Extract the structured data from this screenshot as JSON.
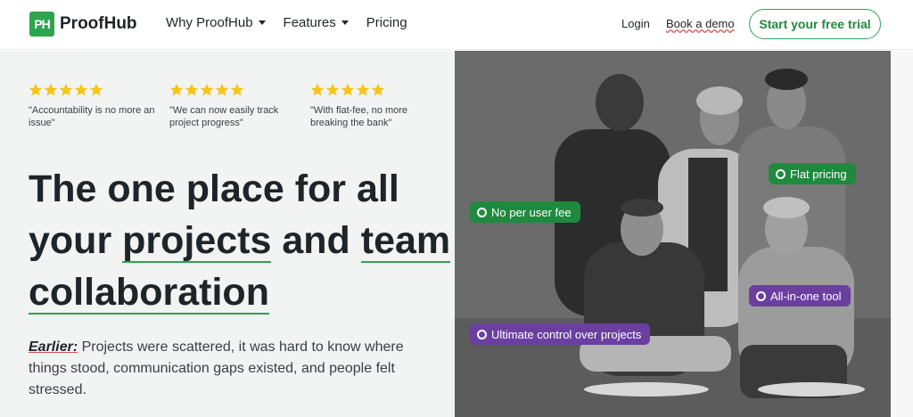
{
  "header": {
    "logo_mark": "PH",
    "logo_text": "ProofHub",
    "nav": [
      {
        "label": "Why ProofHub",
        "has_dropdown": true
      },
      {
        "label": "Features",
        "has_dropdown": true
      },
      {
        "label": "Pricing",
        "has_dropdown": false
      }
    ],
    "login_label": "Login",
    "demo_label": "Book a demo",
    "trial_label": "Start your free trial"
  },
  "reviews": [
    {
      "stars": 5,
      "text": "\"Accountability is no more an issue\""
    },
    {
      "stars": 5,
      "text": "\"We can now easily track project progress\""
    },
    {
      "stars": 5,
      "text": "\"With flat-fee, no more breaking the bank\""
    }
  ],
  "headline": {
    "part1": "The one place for all your ",
    "word1": "projects",
    "part2": " and ",
    "word2": "team",
    "word3": "collaboration"
  },
  "description": {
    "lead": "Earlier:",
    "text": " Projects were scattered, it was hard to know where things stood, communication gaps existed, and people felt stressed."
  },
  "photo_tags": [
    {
      "label": "No per user fee",
      "color": "green"
    },
    {
      "label": "Flat pricing",
      "color": "green"
    },
    {
      "label": "All-in-one tool",
      "color": "purple"
    },
    {
      "label": "Ultimate control over projects",
      "color": "purple"
    }
  ],
  "colors": {
    "brand_green": "#2ea44f",
    "tag_purple": "#6b3fa0",
    "star_yellow": "#f5c518"
  }
}
